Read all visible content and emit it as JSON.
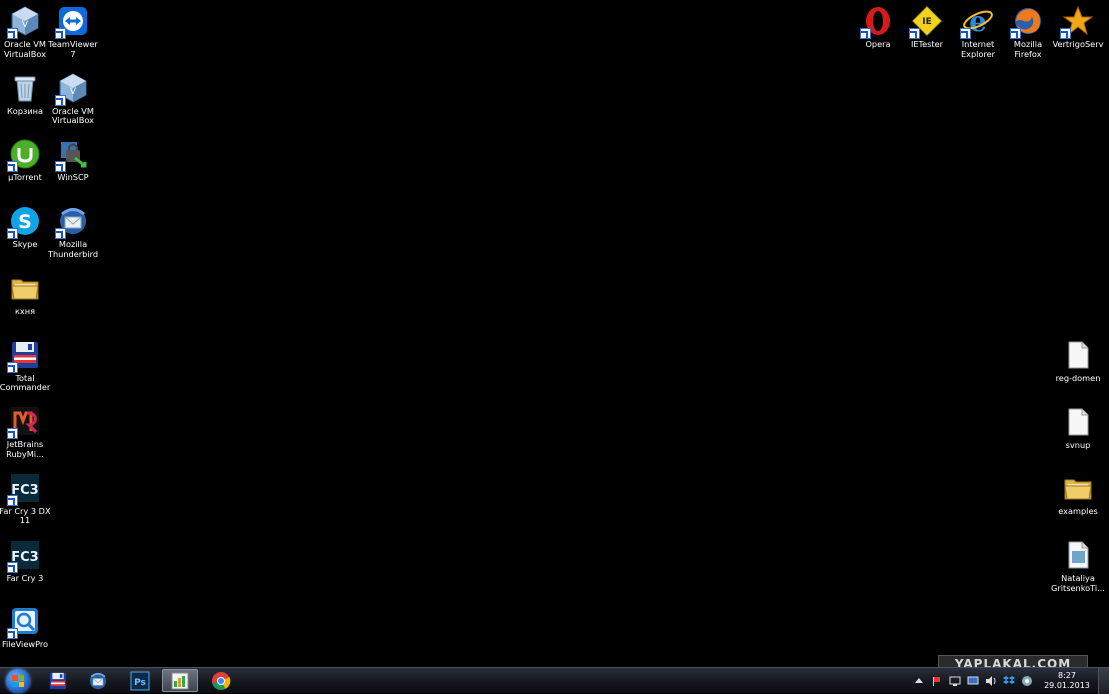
{
  "desktop": {
    "left_column_1": [
      {
        "label": "Oracle VM VirtualBox",
        "icon": "virtualbox-icon",
        "shortcut": true
      },
      {
        "label": "Корзина",
        "icon": "recycle-bin-icon",
        "shortcut": false
      },
      {
        "label": "µTorrent",
        "icon": "utorrent-icon",
        "shortcut": true
      },
      {
        "label": "Skype",
        "icon": "skype-icon",
        "shortcut": true
      },
      {
        "label": "кхня",
        "icon": "folder-icon",
        "shortcut": false
      },
      {
        "label": "Total Commander",
        "icon": "total-commander-icon",
        "shortcut": true
      },
      {
        "label": "JetBrains RubyMi...",
        "icon": "rubymine-icon",
        "shortcut": true
      },
      {
        "label": "Far Cry 3 DX 11",
        "icon": "farcry3-icon",
        "shortcut": true
      },
      {
        "label": "Far Cry 3",
        "icon": "farcry3-icon",
        "shortcut": true
      },
      {
        "label": "FileViewPro",
        "icon": "fileviewpro-icon",
        "shortcut": true
      }
    ],
    "left_column_2": [
      {
        "label": "TeamViewer 7",
        "icon": "teamviewer-icon",
        "shortcut": true
      },
      {
        "label": "Oracle VM VirtualBox",
        "icon": "virtualbox-icon",
        "shortcut": true
      },
      {
        "label": "WinSCP",
        "icon": "winscp-icon",
        "shortcut": true
      },
      {
        "label": "Mozilla Thunderbird",
        "icon": "thunderbird-icon",
        "shortcut": true
      }
    ],
    "top_right": [
      {
        "label": "Opera",
        "icon": "opera-icon",
        "shortcut": true
      },
      {
        "label": "IETester",
        "icon": "ietester-icon",
        "shortcut": true
      },
      {
        "label": "Internet Explorer",
        "icon": "internet-explorer-icon",
        "shortcut": true
      },
      {
        "label": "Mozilla Firefox",
        "icon": "firefox-icon",
        "shortcut": true
      },
      {
        "label": "VertrigoServ",
        "icon": "vertrigoserv-icon",
        "shortcut": true
      }
    ],
    "right_column": [
      {
        "label": "reg-domen",
        "icon": "text-file-icon",
        "shortcut": false
      },
      {
        "label": "svnup",
        "icon": "text-file-icon",
        "shortcut": false
      },
      {
        "label": "examples",
        "icon": "folder-icon",
        "shortcut": false
      },
      {
        "label": "Nataliya GritsenkoTi...",
        "icon": "document-icon",
        "shortcut": false
      }
    ]
  },
  "taskbar": {
    "pinned": [
      {
        "name": "total-commander",
        "icon": "total-commander-icon",
        "active": false
      },
      {
        "name": "thunderbird",
        "icon": "thunderbird-icon",
        "active": false
      },
      {
        "name": "photoshop",
        "icon": "photoshop-icon",
        "active": false,
        "text": "Ps"
      },
      {
        "name": "utorrent",
        "icon": "app-window-icon",
        "active": true
      },
      {
        "name": "chrome",
        "icon": "chrome-icon",
        "active": false
      }
    ],
    "tray_icons": [
      "tray-arrow-icon",
      "flag-icon",
      "network-icon",
      "monitor-icon",
      "volume-icon",
      "dropbox-icon",
      "tray-app-icon"
    ],
    "clock": {
      "time": "8:27",
      "date": "29.01.2013"
    }
  },
  "watermark": "YAPLAKAL.COM",
  "colors": {
    "desktop_bg": "#000000",
    "taskbar_bg": "#15181f"
  }
}
